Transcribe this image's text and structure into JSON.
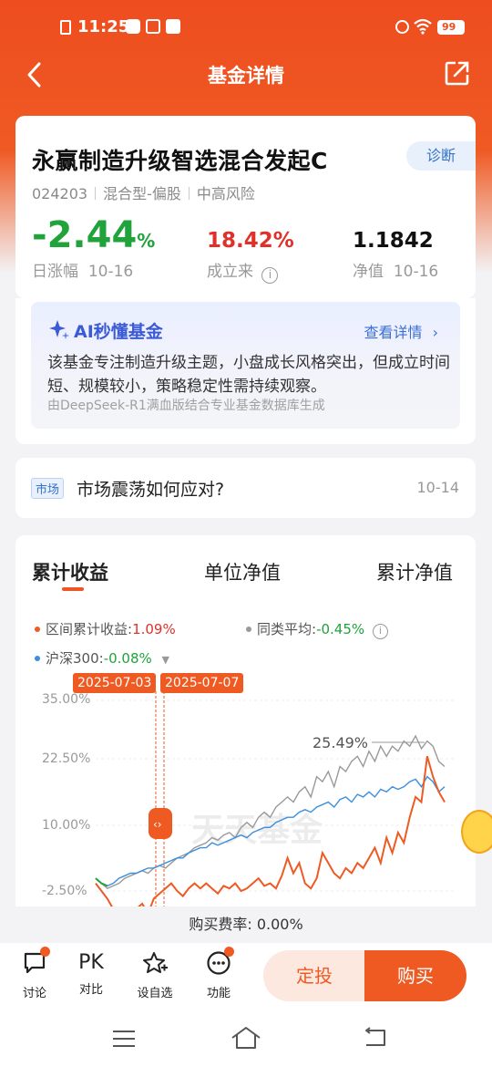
{
  "status_bar": {
    "time": "11:25",
    "battery": "99"
  },
  "navbar": {
    "title": "基金详情"
  },
  "fund": {
    "name": "永赢制造升级智选混合发起C",
    "diagnose_label": "诊断",
    "code": "024203",
    "type": "混合型-偏股",
    "risk": "中高风险",
    "daily_change": "-2.44",
    "daily_change_unit": "%",
    "daily_change_label": "日涨幅",
    "daily_change_date": "10-16",
    "since_inception": "18.42%",
    "since_inception_label": "成立来",
    "nav": "1.1842",
    "nav_label": "净值",
    "nav_date": "10-16"
  },
  "ai_card": {
    "title": "AI秒懂基金",
    "link": "查看详情",
    "body": "该基金专注制造升级主题，小盘成长风格突出，但成立时间短、规模较小，策略稳定性需持续观察。",
    "footer": "由DeepSeek-R1满血版结合专业基金数据库生成"
  },
  "news": {
    "tag": "市场",
    "title": "市场震荡如何应对?",
    "date": "10-14"
  },
  "chart_tabs": [
    "累计收益",
    "单位净值",
    "累计净值"
  ],
  "legend": {
    "fund_label": "区间累计收益:",
    "fund_value": "1.09%",
    "peer_label": "同类平均:",
    "peer_value": "-0.45%",
    "index_label": "沪深300:",
    "index_value": "-0.08%"
  },
  "date_tags": [
    "2025-07-03",
    "2025-07-07"
  ],
  "peak_label": "25.49%",
  "watermark": "天天基金",
  "colors": {
    "fund": "#ee5a22",
    "peer": "#999999",
    "index": "#3b8fde",
    "down": "#1fa33a",
    "up": "#e0302a"
  },
  "chart_data": {
    "type": "line",
    "ytick_labels": [
      "35.00%",
      "22.50%",
      "10.00%",
      "-2.50%"
    ],
    "ylim": [
      -5,
      35
    ],
    "x": [
      0,
      1,
      2,
      3,
      4,
      5,
      6,
      7,
      8,
      9,
      10,
      11,
      12,
      13,
      14,
      15,
      16,
      17,
      18,
      19,
      20,
      21,
      22,
      23,
      24,
      25,
      26,
      27,
      28,
      29,
      30,
      31,
      32,
      33,
      34,
      35,
      36,
      37,
      38,
      39,
      40,
      41,
      42,
      43,
      44,
      45,
      46,
      47,
      48,
      49,
      50,
      51,
      52,
      53,
      54,
      55,
      56,
      57,
      58,
      59,
      60
    ],
    "series": [
      {
        "name": "区间累计收益",
        "color": "#ee5a22",
        "values": [
          -1,
          -2.5,
          -4,
          -6,
          -7,
          -9,
          -8,
          -6,
          -5,
          -7,
          -4,
          -3,
          -2,
          -1,
          -2.5,
          -3.5,
          -2,
          -1,
          -2,
          -1,
          -2,
          -3,
          -1.5,
          -2,
          -1,
          -2.5,
          -2,
          -1,
          0,
          -1.5,
          -1,
          -2,
          0.5,
          4,
          1,
          3,
          -1,
          -2,
          0,
          5,
          3,
          1,
          0,
          2,
          1,
          3,
          2,
          4,
          6,
          3,
          8,
          5,
          9,
          7,
          12,
          16,
          15,
          24,
          20,
          17,
          15
        ]
      },
      {
        "name": "同类平均",
        "color": "#999999",
        "values": [
          0,
          -1,
          -2,
          -1.5,
          -1,
          0,
          0.5,
          1,
          1.5,
          1,
          2,
          2.5,
          2,
          3,
          4,
          4.5,
          5,
          6,
          6.5,
          7,
          8,
          7.5,
          8.5,
          9,
          8,
          10,
          11,
          10,
          12,
          13,
          12,
          14,
          15,
          16,
          15,
          17,
          18,
          16,
          20,
          19,
          21,
          18,
          22,
          21,
          23,
          24,
          22,
          25,
          23,
          26,
          24,
          26,
          25,
          27,
          26,
          28,
          25.5,
          27,
          26,
          23,
          22
        ]
      },
      {
        "name": "沪深300",
        "color": "#3b8fde",
        "values": [
          0,
          -1,
          -1.5,
          -1,
          0,
          0.5,
          1,
          1,
          1.5,
          2,
          2,
          2.5,
          3,
          3.5,
          4,
          4,
          5,
          5.5,
          6,
          6,
          7,
          6.5,
          7,
          7.5,
          8,
          8.5,
          8,
          9,
          9.5,
          10,
          10,
          11,
          11.5,
          12,
          12,
          13,
          13.5,
          13,
          14,
          14.5,
          15,
          14,
          15.5,
          16,
          15,
          16.5,
          16,
          17,
          16,
          17.5,
          17,
          18,
          17.5,
          18,
          19,
          19.5,
          18,
          20,
          19,
          17,
          18
        ]
      }
    ]
  },
  "fee": {
    "label": "购买费率:",
    "value": "0.00%"
  },
  "bottom_actions": [
    "讨论",
    "对比",
    "设自选",
    "功能"
  ],
  "pk_label": "PK",
  "buttons": {
    "dingtou": "定投",
    "buy": "购买"
  }
}
